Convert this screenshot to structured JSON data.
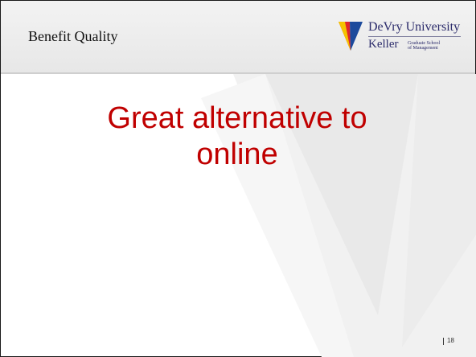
{
  "header": {
    "title": "Benefit Quality"
  },
  "logo": {
    "name": "DeVry University",
    "school": "Keller",
    "school_sub_line1": "Graduate School",
    "school_sub_line2": "of Management",
    "icon": "devry-shield-logo"
  },
  "main": {
    "title_line1": "Great alternative to",
    "title_line2": "online"
  },
  "footer": {
    "page_number": "18"
  },
  "colors": {
    "title": "#c00000",
    "shield_red": "#e0262b",
    "shield_yellow": "#f5c400",
    "shield_blue": "#1c4a9c"
  }
}
